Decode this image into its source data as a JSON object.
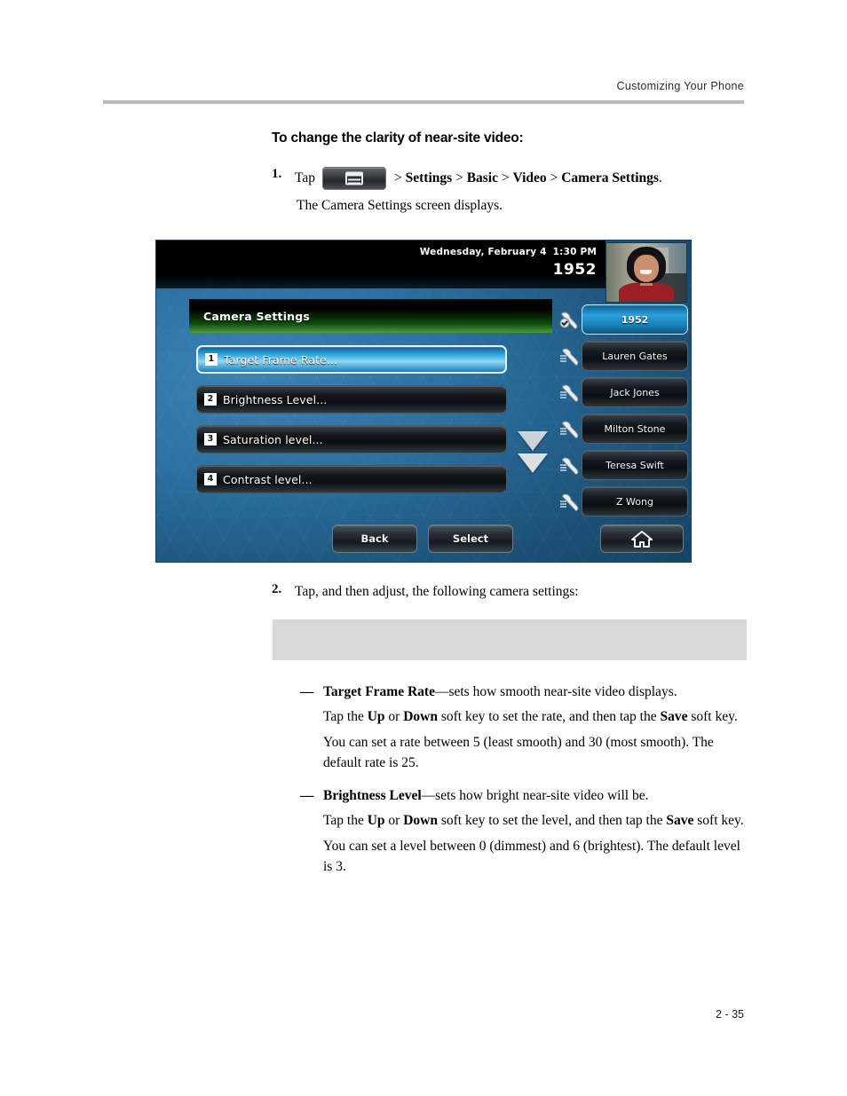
{
  "header": {
    "title": "Customizing Your Phone"
  },
  "section": {
    "heading": "To change the clarity of near-site video:"
  },
  "steps": {
    "one": {
      "number": "1.",
      "tap_label": "Tap",
      "menu_key_icon": "menu-key-icon",
      "breadcrumb_plain": "> ",
      "breadcrumb": "> Settings > Basic > Video > Camera Settings.",
      "crumb_settings": "Settings",
      "crumb_basic": "Basic",
      "crumb_video": "Video",
      "crumb_camera_settings": "Camera Settings",
      "separator": ">",
      "period": ".",
      "result": "The Camera Settings screen displays."
    },
    "two": {
      "number": "2.",
      "text": "Tap, and then adjust, the following camera settings:"
    }
  },
  "phone_screen": {
    "status": {
      "date": "Wednesday, February 4",
      "time": "1:30 PM",
      "extension": "1952"
    },
    "video_thumbnail": "near-site-video-thumbnail",
    "title": "Camera Settings",
    "menu_items": [
      {
        "index": "1",
        "label": "Target Frame Rate...",
        "selected": true
      },
      {
        "index": "2",
        "label": "Brightness Level...",
        "selected": false
      },
      {
        "index": "3",
        "label": "Saturation level...",
        "selected": false
      },
      {
        "index": "4",
        "label": "Contrast level...",
        "selected": false
      }
    ],
    "scroll_indicator": "scroll-down-arrows",
    "line_keys": [
      {
        "label": "1952",
        "icon": "handset-registered-icon",
        "active": true
      },
      {
        "label": "Lauren Gates",
        "icon": "handset-icon",
        "active": false
      },
      {
        "label": "Jack Jones",
        "icon": "handset-icon",
        "active": false
      },
      {
        "label": "Milton Stone",
        "icon": "handset-icon",
        "active": false
      },
      {
        "label": "Teresa Swift",
        "icon": "handset-icon",
        "active": false
      },
      {
        "label": "Z Wong",
        "icon": "handset-icon",
        "active": false
      }
    ],
    "soft_keys": {
      "back": "Back",
      "select": "Select",
      "home_icon": "home-icon"
    },
    "colors": {
      "background": "#2a6f9f",
      "title_gradient_end": "#4e9a3a",
      "selected_item": "#2fa6df",
      "status_bar": "#000000"
    }
  },
  "callout": {
    "text": ""
  },
  "bullets": [
    {
      "dash": "—",
      "term": "Target Frame Rate",
      "separator": "—",
      "description": "sets how smooth near-site video displays.",
      "paragraphs": [
        {
          "p1": "Tap the ",
          "b1": "Up",
          "p2": " or ",
          "b2": "Down",
          "p3": " soft key to set the rate, and then tap the ",
          "b3": "Save",
          "p4": " soft key."
        },
        {
          "plain": "You can set a rate between 5 (least smooth) and 30 (most smooth). The default rate is 25."
        }
      ]
    },
    {
      "dash": "—",
      "term": "Brightness Level",
      "separator": "—",
      "description": "sets how bright near-site video will be.",
      "paragraphs": [
        {
          "p1": "Tap the ",
          "b1": "Up",
          "p2": " or ",
          "b2": "Down",
          "p3": " soft key to set the level, and then tap the ",
          "b3": "Save",
          "p4": " soft key."
        },
        {
          "plain": "You can set a level between 0 (dimmest) and 6 (brightest). The default level is 3."
        }
      ]
    }
  ],
  "footer": {
    "page_number": "2 - 35"
  }
}
